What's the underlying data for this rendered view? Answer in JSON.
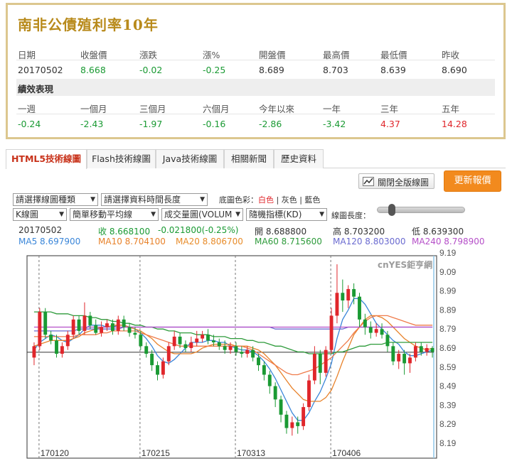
{
  "quote": {
    "title": "南非公債殖利率10年",
    "headers": [
      "日期",
      "收盤價",
      "漲跌",
      "漲%",
      "開盤價",
      "最高價",
      "最低價",
      "昨收"
    ],
    "values": [
      "20170502",
      "8.668",
      "-0.02",
      "-0.25",
      "8.689",
      "8.703",
      "8.639",
      "8.690"
    ],
    "performance_title": "績效表現",
    "perf_headers": [
      "一週",
      "一個月",
      "三個月",
      "六個月",
      "今年以來",
      "一年",
      "三年",
      "五年"
    ],
    "perf_values": [
      "-0.24",
      "-2.43",
      "-1.97",
      "-0.16",
      "-2.86",
      "-3.42",
      "4.37",
      "14.28"
    ]
  },
  "tabs": [
    "HTML5技術線圖",
    "Flash技術線圖",
    "Java技術線圖",
    "相關新聞",
    "歷史資料"
  ],
  "toolbar": {
    "close_chart_label": "關閉全版線圖",
    "refresh_label": "更新報價",
    "chart_type_select": "請選擇線圖種類",
    "time_range_select": "請選擇資料時間長度",
    "bg_color_label": "底圖色彩：",
    "bg_colors": [
      "白色",
      "灰色",
      "藍色"
    ],
    "kline_select": "K線圖",
    "ma_select": "簡單移動平均線",
    "volume_select": "成交量圖(VOLUM",
    "indicator_select": "隨機指標(KD)",
    "range_label": "線圖長度："
  },
  "readout": {
    "date": "20170502",
    "close": "收 8.668100",
    "change": "-0.021800(-0.25%)",
    "open": "開 8.688800",
    "high": "高 8.703200",
    "low": "低 8.639300",
    "ma5": "MA5 8.697900",
    "ma10": "MA10 8.704100",
    "ma20": "MA20 8.806700",
    "ma60": "MA60 8.715600",
    "ma120": "MA120 8.803000",
    "ma240": "MA240 8.798900"
  },
  "watermark": "cnYES鉅亨網",
  "colors": {
    "up": "#e0262b",
    "down": "#1a9a33",
    "accent": "#f28a1e",
    "title_gold": "#b88a1b"
  },
  "chart_data": {
    "type": "candlestick",
    "ylim": [
      8.19,
      9.19
    ],
    "y_ticks": [
      "9.19",
      "9.09",
      "8.99",
      "8.89",
      "8.79",
      "8.69",
      "8.59",
      "8.49",
      "8.39",
      "8.29",
      "8.19"
    ],
    "x_ticks": [
      "170120",
      "170215",
      "170313",
      "170406"
    ],
    "last_close": 8.668,
    "candles": [
      [
        8.64,
        8.7,
        8.6,
        8.72
      ],
      [
        8.7,
        8.88,
        8.68,
        8.9
      ],
      [
        8.88,
        8.76,
        8.74,
        8.9
      ],
      [
        8.76,
        8.73,
        8.71,
        8.78
      ],
      [
        8.73,
        8.66,
        8.64,
        8.76
      ],
      [
        8.66,
        8.7,
        8.64,
        8.72
      ],
      [
        8.7,
        8.76,
        8.68,
        8.78
      ],
      [
        8.76,
        8.84,
        8.74,
        8.86
      ],
      [
        8.84,
        8.78,
        8.76,
        8.86
      ],
      [
        8.78,
        8.86,
        8.76,
        8.93
      ],
      [
        8.86,
        8.81,
        8.79,
        8.88
      ],
      [
        8.81,
        8.77,
        8.76,
        8.84
      ],
      [
        8.77,
        8.8,
        8.75,
        8.83
      ],
      [
        8.8,
        8.82,
        8.78,
        8.84
      ],
      [
        8.82,
        8.78,
        8.76,
        8.84
      ],
      [
        8.78,
        8.84,
        8.76,
        8.86
      ],
      [
        8.84,
        8.8,
        8.78,
        8.86
      ],
      [
        8.8,
        8.77,
        8.75,
        8.82
      ],
      [
        8.77,
        8.76,
        8.74,
        8.8
      ],
      [
        8.76,
        8.7,
        8.68,
        8.78
      ],
      [
        8.7,
        8.66,
        8.64,
        8.72
      ],
      [
        8.66,
        8.6,
        8.57,
        8.68
      ],
      [
        8.6,
        8.55,
        8.52,
        8.62
      ],
      [
        8.55,
        8.62,
        8.53,
        8.64
      ],
      [
        8.62,
        8.7,
        8.6,
        8.72
      ],
      [
        8.7,
        8.75,
        8.68,
        8.78
      ],
      [
        8.75,
        8.71,
        8.69,
        8.77
      ],
      [
        8.71,
        8.69,
        8.67,
        8.73
      ],
      [
        8.69,
        8.72,
        8.67,
        8.75
      ],
      [
        8.72,
        8.74,
        8.7,
        8.78
      ],
      [
        8.74,
        8.76,
        8.72,
        8.78
      ],
      [
        8.76,
        8.73,
        8.71,
        8.79
      ],
      [
        8.73,
        8.72,
        8.7,
        8.76
      ],
      [
        8.72,
        8.7,
        8.68,
        8.74
      ],
      [
        8.7,
        8.68,
        8.66,
        8.73
      ],
      [
        8.68,
        8.7,
        8.66,
        8.72
      ],
      [
        8.7,
        8.67,
        8.65,
        8.72
      ],
      [
        8.67,
        8.66,
        8.64,
        8.7
      ],
      [
        8.66,
        8.68,
        8.64,
        8.7
      ],
      [
        8.68,
        8.64,
        8.62,
        8.7
      ],
      [
        8.64,
        8.6,
        8.57,
        8.66
      ],
      [
        8.6,
        8.55,
        8.52,
        8.62
      ],
      [
        8.55,
        8.49,
        8.45,
        8.57
      ],
      [
        8.49,
        8.42,
        8.38,
        8.51
      ],
      [
        8.42,
        8.34,
        8.3,
        8.44
      ],
      [
        8.34,
        8.27,
        8.24,
        8.36
      ],
      [
        8.27,
        8.3,
        8.23,
        8.33
      ],
      [
        8.3,
        8.28,
        8.24,
        8.33
      ],
      [
        8.28,
        8.38,
        8.26,
        8.4
      ],
      [
        8.38,
        8.52,
        8.36,
        8.55
      ],
      [
        8.52,
        8.66,
        8.5,
        8.7
      ],
      [
        8.66,
        8.56,
        8.5,
        8.68
      ],
      [
        8.56,
        8.68,
        8.54,
        8.7
      ],
      [
        8.68,
        8.86,
        8.66,
        8.9
      ],
      [
        8.86,
        8.98,
        8.82,
        9.13
      ],
      [
        8.98,
        8.94,
        8.88,
        9.05
      ],
      [
        8.94,
        9.0,
        8.9,
        9.02
      ],
      [
        9.0,
        8.96,
        8.92,
        9.03
      ],
      [
        8.96,
        8.84,
        8.8,
        8.98
      ],
      [
        8.84,
        8.8,
        8.76,
        8.87
      ],
      [
        8.8,
        8.77,
        8.74,
        8.83
      ],
      [
        8.77,
        8.79,
        8.75,
        8.82
      ],
      [
        8.79,
        8.76,
        8.74,
        8.82
      ],
      [
        8.76,
        8.7,
        8.67,
        8.78
      ],
      [
        8.7,
        8.62,
        8.6,
        8.72
      ],
      [
        8.62,
        8.66,
        8.58,
        8.68
      ],
      [
        8.66,
        8.61,
        8.55,
        8.68
      ],
      [
        8.61,
        8.64,
        8.56,
        8.66
      ],
      [
        8.64,
        8.7,
        8.62,
        8.72
      ],
      [
        8.7,
        8.67,
        8.65,
        8.72
      ],
      [
        8.67,
        8.69,
        8.65,
        8.71
      ],
      [
        8.69,
        8.67,
        8.64,
        8.7
      ]
    ],
    "ma_series": [
      {
        "name": "MA5",
        "color": "#3a86d9",
        "values": [
          8.68,
          8.72,
          8.74,
          8.76,
          8.75,
          8.73,
          8.72,
          8.74,
          8.76,
          8.79,
          8.81,
          8.81,
          8.81,
          8.8,
          8.8,
          8.81,
          8.81,
          8.8,
          8.79,
          8.77,
          8.74,
          8.7,
          8.65,
          8.62,
          8.61,
          8.63,
          8.66,
          8.69,
          8.72,
          8.72,
          8.72,
          8.73,
          8.73,
          8.72,
          8.72,
          8.7,
          8.69,
          8.68,
          8.68,
          8.67,
          8.65,
          8.62,
          8.58,
          8.53,
          8.47,
          8.41,
          8.35,
          8.31,
          8.31,
          8.35,
          8.41,
          8.46,
          8.53,
          8.61,
          8.74,
          8.84,
          8.89,
          8.95,
          8.95,
          8.92,
          8.87,
          8.82,
          8.79,
          8.76,
          8.73,
          8.71,
          8.67,
          8.65,
          8.65,
          8.66,
          8.67,
          8.68
        ]
      },
      {
        "name": "MA10",
        "color": "#e8822a",
        "values": [
          8.7,
          8.71,
          8.72,
          8.73,
          8.73,
          8.73,
          8.73,
          8.74,
          8.75,
          8.77,
          8.78,
          8.79,
          8.8,
          8.8,
          8.81,
          8.81,
          8.81,
          8.8,
          8.79,
          8.78,
          8.76,
          8.74,
          8.71,
          8.69,
          8.67,
          8.66,
          8.66,
          8.66,
          8.66,
          8.67,
          8.69,
          8.7,
          8.71,
          8.71,
          8.71,
          8.71,
          8.7,
          8.7,
          8.7,
          8.69,
          8.68,
          8.66,
          8.63,
          8.6,
          8.56,
          8.52,
          8.48,
          8.45,
          8.42,
          8.41,
          8.41,
          8.41,
          8.43,
          8.47,
          8.54,
          8.62,
          8.69,
          8.76,
          8.8,
          8.84,
          8.86,
          8.86,
          8.85,
          8.83,
          8.8,
          8.77,
          8.74,
          8.72,
          8.7,
          8.69,
          8.68,
          8.69
        ]
      },
      {
        "name": "MA20",
        "color": "#ef7b4a",
        "values": [
          8.75,
          8.75,
          8.75,
          8.75,
          8.75,
          8.75,
          8.75,
          8.75,
          8.76,
          8.76,
          8.76,
          8.76,
          8.77,
          8.77,
          8.78,
          8.78,
          8.78,
          8.78,
          8.78,
          8.77,
          8.76,
          8.75,
          8.74,
          8.73,
          8.72,
          8.71,
          8.7,
          8.7,
          8.7,
          8.7,
          8.7,
          8.7,
          8.7,
          8.7,
          8.7,
          8.7,
          8.7,
          8.7,
          8.69,
          8.68,
          8.66,
          8.64,
          8.62,
          8.6,
          8.58,
          8.56,
          8.55,
          8.55,
          8.56,
          8.57,
          8.58,
          8.6,
          8.62,
          8.64,
          8.67,
          8.7,
          8.73,
          8.77,
          8.8,
          8.83,
          8.85,
          8.86,
          8.86,
          8.86,
          8.85,
          8.84,
          8.83,
          8.82,
          8.81,
          8.81,
          8.81,
          8.81
        ]
      },
      {
        "name": "MA60",
        "color": "#2e9b3b",
        "values": [
          8.88,
          8.88,
          8.88,
          8.88,
          8.87,
          8.87,
          8.87,
          8.86,
          8.86,
          8.86,
          8.85,
          8.85,
          8.84,
          8.84,
          8.83,
          8.83,
          8.82,
          8.82,
          8.81,
          8.81,
          8.8,
          8.8,
          8.79,
          8.79,
          8.78,
          8.78,
          8.77,
          8.77,
          8.77,
          8.76,
          8.76,
          8.76,
          8.75,
          8.75,
          8.75,
          8.74,
          8.74,
          8.74,
          8.73,
          8.73,
          8.72,
          8.72,
          8.71,
          8.7,
          8.7,
          8.69,
          8.68,
          8.67,
          8.67,
          8.66,
          8.66,
          8.66,
          8.66,
          8.66,
          8.67,
          8.67,
          8.68,
          8.69,
          8.7,
          8.7,
          8.71,
          8.71,
          8.71,
          8.72,
          8.72,
          8.72,
          8.72,
          8.72,
          8.72,
          8.72,
          8.72,
          8.72
        ]
      },
      {
        "name": "MA120",
        "color": "#6a6ad0",
        "values": [
          8.78,
          8.78,
          8.78,
          8.78,
          8.78,
          8.78,
          8.78,
          8.78,
          8.79,
          8.79,
          8.79,
          8.79,
          8.79,
          8.79,
          8.79,
          8.79,
          8.8,
          8.8,
          8.8,
          8.8,
          8.8,
          8.8,
          8.8,
          8.8,
          8.8,
          8.8,
          8.8,
          8.8,
          8.8,
          8.8,
          8.8,
          8.8,
          8.8,
          8.8,
          8.8,
          8.8,
          8.8,
          8.8,
          8.8,
          8.8,
          8.8,
          8.8,
          8.8,
          8.79,
          8.79,
          8.79,
          8.79,
          8.79,
          8.79,
          8.79,
          8.79,
          8.79,
          8.79,
          8.79,
          8.79,
          8.79,
          8.8,
          8.8,
          8.8,
          8.8,
          8.8,
          8.8,
          8.8,
          8.8,
          8.8,
          8.8,
          8.8,
          8.8,
          8.8,
          8.8,
          8.8,
          8.8
        ]
      },
      {
        "name": "MA240",
        "color": "#b54fc8",
        "values": [
          8.8,
          8.8,
          8.8,
          8.8,
          8.8,
          8.8,
          8.8,
          8.8,
          8.8,
          8.8,
          8.8,
          8.8,
          8.8,
          8.8,
          8.8,
          8.8,
          8.8,
          8.8,
          8.8,
          8.8,
          8.8,
          8.8,
          8.8,
          8.8,
          8.8,
          8.8,
          8.8,
          8.8,
          8.8,
          8.8,
          8.8,
          8.8,
          8.8,
          8.8,
          8.8,
          8.8,
          8.8,
          8.8,
          8.8,
          8.8,
          8.8,
          8.8,
          8.8,
          8.8,
          8.8,
          8.8,
          8.8,
          8.8,
          8.8,
          8.8,
          8.8,
          8.8,
          8.8,
          8.8,
          8.8,
          8.8,
          8.8,
          8.8,
          8.8,
          8.8,
          8.8,
          8.8,
          8.8,
          8.8,
          8.8,
          8.8,
          8.8,
          8.8,
          8.8,
          8.8,
          8.8,
          8.8
        ]
      }
    ]
  }
}
